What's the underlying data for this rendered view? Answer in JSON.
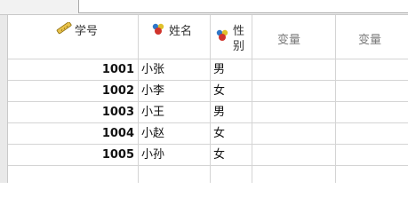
{
  "columns": {
    "id": {
      "label": "学号",
      "icon": "ruler-icon"
    },
    "name": {
      "label": "姓名",
      "icon": "nominal-measure-icon"
    },
    "sex": {
      "label_line1": "性",
      "label_line2": "别",
      "icon": "nominal-measure-icon"
    },
    "var1": {
      "label": "变量"
    },
    "var2": {
      "label": "变量"
    }
  },
  "rows": [
    {
      "id": "1001",
      "name": "小张",
      "sex": "男"
    },
    {
      "id": "1002",
      "name": "小李",
      "sex": "女"
    },
    {
      "id": "1003",
      "name": "小王",
      "sex": "男"
    },
    {
      "id": "1004",
      "name": "小赵",
      "sex": "女"
    },
    {
      "id": "1005",
      "name": "小孙",
      "sex": "女"
    }
  ],
  "colors": {
    "header_bg": "#ffffff",
    "grid_line": "#d4d4d4",
    "variable_placeholder_text": "#7a7a7a"
  }
}
